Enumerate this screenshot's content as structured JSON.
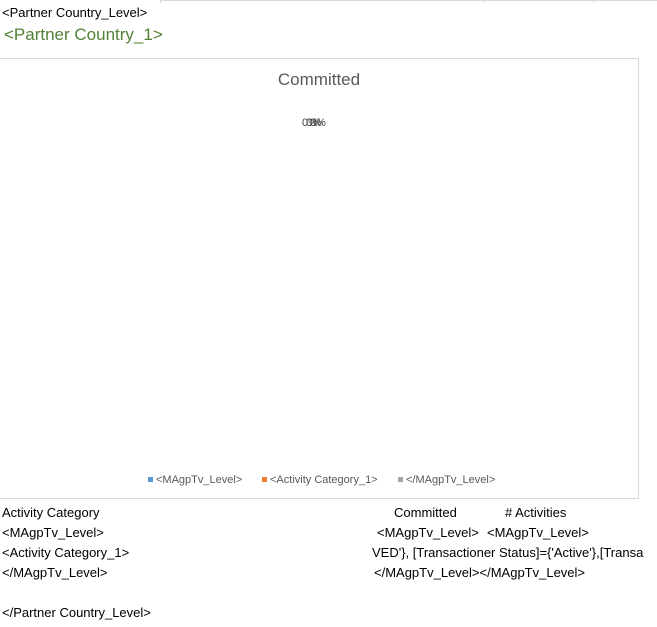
{
  "report": {
    "open_tag": "<Partner Country_Level>",
    "heading": "<Partner Country_1>",
    "heading_color": "#538135",
    "close_tag": "</Partner Country_Level>"
  },
  "chart_data": {
    "type": "pie",
    "title": "Committed",
    "slice_labels": [
      "0%",
      "0%",
      "0%"
    ],
    "series": [
      {
        "name": "<MAgpTv_Level>",
        "color": "#5b9bd5"
      },
      {
        "name": "<Activity Category_1>",
        "color": "#ed7d31"
      },
      {
        "name": "</MAgpTv_Level>",
        "color": "#a5a5a5"
      }
    ]
  },
  "table": {
    "headers": [
      "Activity Category",
      "Committed",
      "# Activities"
    ],
    "rows": [
      [
        "<MAgpTv_Level>",
        "<MAgpTv_Level>",
        "<MAgpTv_Level>"
      ],
      [
        "<Activity Category_1>",
        "VED'}, [Transactioner Status]={'Active'},[Transa",
        ""
      ],
      [
        "</MAgpTv_Level>",
        "</MAgpTv_Level></MAgpTv_Level>",
        ""
      ]
    ]
  }
}
